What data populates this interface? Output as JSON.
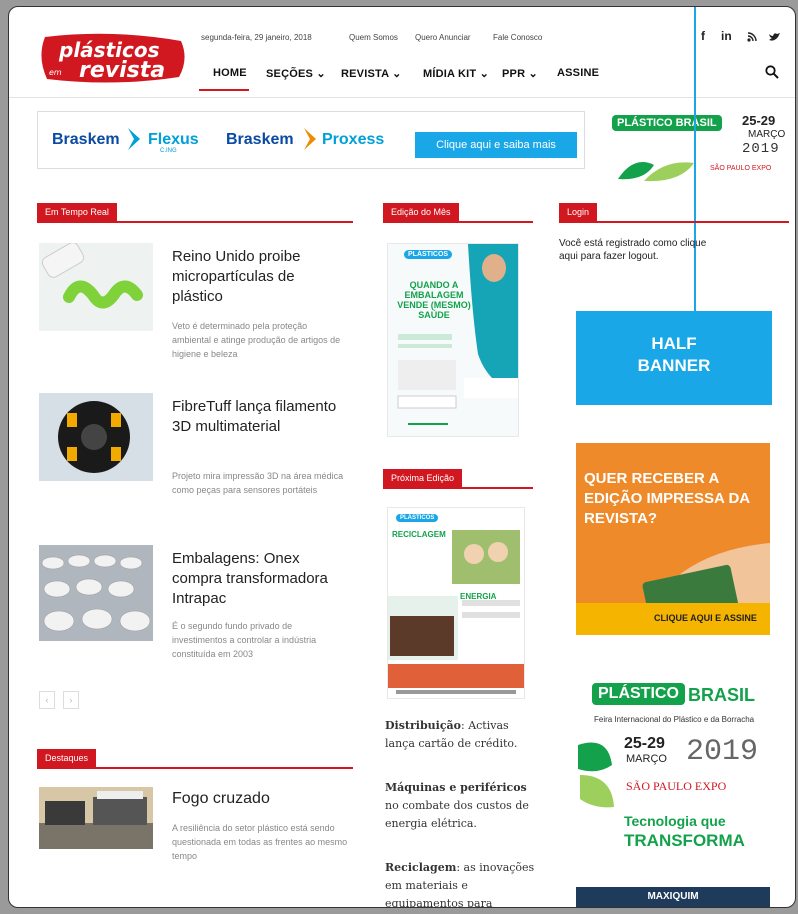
{
  "header": {
    "logo": {
      "line1": "plásticos",
      "line2": "revista",
      "prefix": "em"
    },
    "date": "segunda-feira, 29 janeiro, 2018",
    "top_links": [
      "Quem Somos",
      "Quero Anunciar",
      "Fale Conosco"
    ],
    "social": [
      "f",
      "in",
      "rss",
      "tw"
    ],
    "nav": [
      "HOME",
      "SEÇÕES",
      "REVISTA",
      "MÍDIA KIT",
      "PPR",
      "ASSINE"
    ],
    "active_nav": "HOME"
  },
  "banner": {
    "brand1": "Braskem",
    "prod1": "Flexus",
    "prod1_sub": "C.ING",
    "brand2": "Braskem",
    "prod2": "Proxess",
    "cta": "Clique aqui e saiba mais"
  },
  "promo_top": {
    "logo": "PLÁSTICO BRASIL",
    "dates": "25-29",
    "month": "MARÇO",
    "year": "2019",
    "venue": "SÃO PAULO EXPO"
  },
  "sections": {
    "realtime": "Em Tempo Real",
    "edicao": "Edição do Mês",
    "login": "Login",
    "proxima": "Próxima Edição",
    "destaques": "Destaques"
  },
  "articles": [
    {
      "title": "Reino Unido proibe micropartículas de plástico",
      "text": "Veto é determinado pela proteção ambiental e atinge produção de artigos de higiene e beleza"
    },
    {
      "title": "FibreTuff lança filamento 3D multimaterial",
      "text": "Projeto mira impressão 3D na área médica como peças para sensores portáteis"
    },
    {
      "title": "Embalagens: Onex compra transformadora Intrapac",
      "text": "É o segundo fundo privado de investimentos a controlar a indústria constituída em 2003"
    }
  ],
  "destaque": {
    "title": "Fogo cruzado",
    "text": "A resiliência do setor plástico está sendo questionada em todas as frentes ao mesmo tempo"
  },
  "login_text": "Você está registrado como clique aqui para fazer logout.",
  "half_banner": "HALF BANNER",
  "cover": {
    "badge": "PLÁSTICOS",
    "headline": "QUANDO A EMBALAGEM VENDE (MESMO) SAÚDE"
  },
  "next_edition": {
    "badge": "PLÁSTICOS",
    "h1": "RECICLAGEM",
    "h2": "ENERGIA"
  },
  "side_items": [
    {
      "bold": "Distribuição",
      "text": ": Activas lança cartão de crédito."
    },
    {
      "bold": "Máquinas e periféricos",
      "text": " no combate dos custos de energia elétrica."
    },
    {
      "bold": "Reciclagem",
      "text": ": as inovações em materiais e equipamentos para"
    }
  ],
  "ad_revista": {
    "headline": "QUER RECEBER A EDIÇÃO IMPRESSA DA REVISTA?",
    "cta": "CLIQUE AQUI E ASSINE"
  },
  "promo_side": {
    "logo1": "PLÁSTICO",
    "logo2": "BRASIL",
    "sub": "Feira Internacional do Plástico e da Borracha",
    "dates": "25-29",
    "month": "MARÇO",
    "year": "2019",
    "venue": "SÃO PAULO EXPO",
    "tag1": "Tecnologia que",
    "tag2": "TRANSFORMA"
  },
  "footer_ad": "MAXIQUIM",
  "colors": {
    "red": "#d11820",
    "blue": "#1aa7e8",
    "green": "#13a24b"
  }
}
